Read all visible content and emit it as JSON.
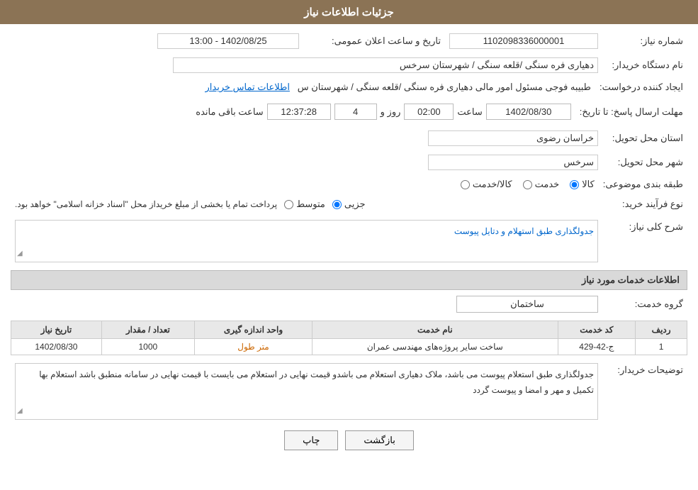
{
  "header": {
    "title": "جزئیات اطلاعات نیاز"
  },
  "fields": {
    "need_number_label": "شماره نیاز:",
    "need_number_value": "1102098336000001",
    "buyer_org_label": "نام دستگاه خریدار:",
    "buyer_org_value": "دهیاری فره سنگی /قلعه سنگی / شهرستان سرخس",
    "announcement_label": "تاریخ و ساعت اعلان عمومی:",
    "announcement_value": "1402/08/25 - 13:00",
    "creator_label": "ایجاد کننده درخواست:",
    "creator_value": "طبیبه فوجی مسئول امور مالی دهیاری فره سنگی /قلعه سنگی / شهرستان س",
    "contact_link": "اطلاعات تماس خریدار",
    "response_deadline_label": "مهلت ارسال پاسخ: تا تاریخ:",
    "response_date": "1402/08/30",
    "response_time_label": "ساعت",
    "response_time": "02:00",
    "response_days_label": "روز و",
    "response_days": "4",
    "response_remaining_label": "ساعت باقی مانده",
    "response_remaining": "12:37:28",
    "province_label": "استان محل تحویل:",
    "province_value": "خراسان رضوی",
    "city_label": "شهر محل تحویل:",
    "city_value": "سرخس",
    "category_label": "طبقه بندی موضوعی:",
    "category_goods": "کالا",
    "category_service": "خدمت",
    "category_goods_service": "کالا/خدمت",
    "purchase_type_label": "نوع فرآیند خرید:",
    "purchase_type_partial": "جزیی",
    "purchase_type_medium": "متوسط",
    "purchase_type_desc": "پرداخت تمام یا بخشی از مبلغ خریداز محل \"اسناد خزانه اسلامی\" خواهد بود.",
    "description_label": "شرح کلی نیاز:",
    "description_value": "جدولگذاری طبق استهلام و دتایل پیوست",
    "services_section_label": "اطلاعات خدمات مورد نیاز",
    "service_group_label": "گروه خدمت:",
    "service_group_value": "ساختمان",
    "table_headers": {
      "row_num": "ردیف",
      "service_code": "کد خدمت",
      "service_name": "نام خدمت",
      "unit": "واحد اندازه گیری",
      "quantity": "تعداد / مقدار",
      "date": "تاریخ نیاز"
    },
    "table_rows": [
      {
        "row": "1",
        "code": "ج-42-429",
        "name": "ساخت سایر پروژه‌های مهندسی عمران",
        "unit": "متر طول",
        "quantity": "1000",
        "date": "1402/08/30"
      }
    ],
    "buyer_notes_label": "توضیحات خریدار:",
    "buyer_notes_value": "جدولگذاری طبق استعلام  پیوست می باشد، ملاک  دهیاری استعلام  می باشدو قیمت نهایی در استعلام می بایست با قیمت  نهایی در سامانه  منطبق باشد استعلام  بها  تکمیل  و مهر و امضا و پیوست  گردد"
  },
  "buttons": {
    "back": "بازگشت",
    "print": "چاپ"
  }
}
